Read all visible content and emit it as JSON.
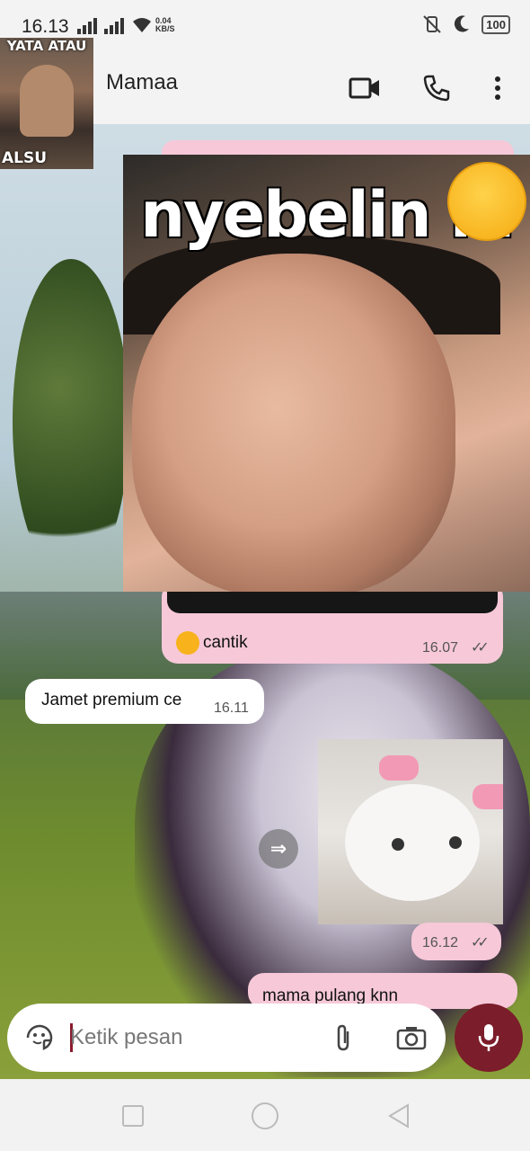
{
  "status": {
    "time": "16.13",
    "speed_value": "0.04",
    "speed_unit": "KB/S",
    "battery": "100",
    "icons": [
      "signal-icon",
      "wifi-icon",
      "vibrate-icon",
      "moon-icon",
      "battery-icon"
    ]
  },
  "header": {
    "contact_name": "Mamaa",
    "avatar_text_top": "YATA ATAU",
    "avatar_text_bottom": "ALSU",
    "icons": [
      "video-call-icon",
      "voice-call-icon",
      "more-options-icon"
    ]
  },
  "messages": [
    {
      "id": "meme",
      "type": "image",
      "direction": "outgoing",
      "image_caption_text": "nyebelin ih"
    },
    {
      "id": "caption",
      "direction": "outgoing",
      "text": "cantik",
      "time": "16.07",
      "ticks": "read"
    },
    {
      "id": "jamet",
      "direction": "incoming",
      "text": "Jamet premium ce",
      "time": "16.11"
    },
    {
      "id": "cat",
      "type": "image",
      "direction": "outgoing",
      "time": "16.12",
      "ticks": "read"
    },
    {
      "id": "mama",
      "direction": "outgoing",
      "text": "mama pulang knn"
    }
  ],
  "composer": {
    "placeholder": "Ketik pesan",
    "icons": [
      "sticker-icon",
      "attach-icon",
      "camera-icon",
      "mic-icon"
    ]
  },
  "navbar": {
    "icons": [
      "recent-apps-icon",
      "home-icon",
      "back-icon"
    ]
  },
  "colors": {
    "outgoing_bubble": "#f6c8d8",
    "incoming_bubble": "#ffffff",
    "accent": "#7b1d2a"
  }
}
